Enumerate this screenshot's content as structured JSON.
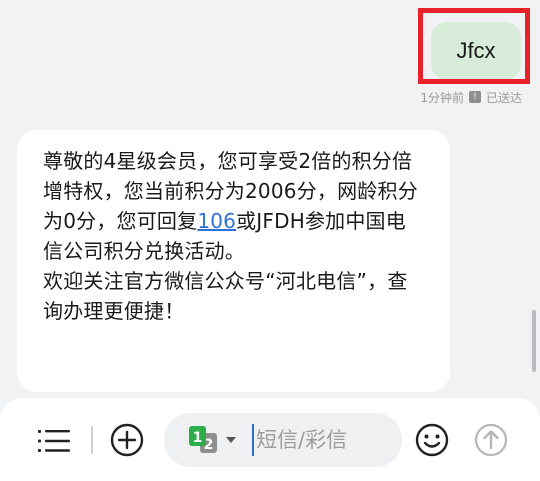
{
  "conversation": {
    "sent_message": "Jfcx",
    "sent_time": "1分钟前",
    "sent_status_icon": "info-icon",
    "sent_status_icon_glyph": "!",
    "sent_status": "已送达",
    "received_message": {
      "part1": "尊敬的4星级会员，您可享受2倍的积分倍增特权，您当前积分为2006分，网龄积分为0分，您可回复",
      "link_text": "106",
      "part2": "或JFDH参加中国电信公司积分兑换活动。",
      "line2": "欢迎关注官方微信公众号“河北电信”，查询办理更便捷！"
    }
  },
  "input_bar": {
    "menu_icon": "list-menu-icon",
    "add_icon": "plus-circle-icon",
    "sim_badge": {
      "primary": "1",
      "secondary": "2"
    },
    "placeholder": "短信/彩信",
    "emoji_icon": "smiley-icon",
    "send_icon": "arrow-up-circle-icon"
  },
  "colors": {
    "sent_bubble": "#d7ecd9",
    "highlight": "#e8212a",
    "link": "#2f73d8",
    "sim_primary": "#2eae4b",
    "sim_secondary": "#8f8f8f",
    "caret": "#2f6fd6"
  }
}
